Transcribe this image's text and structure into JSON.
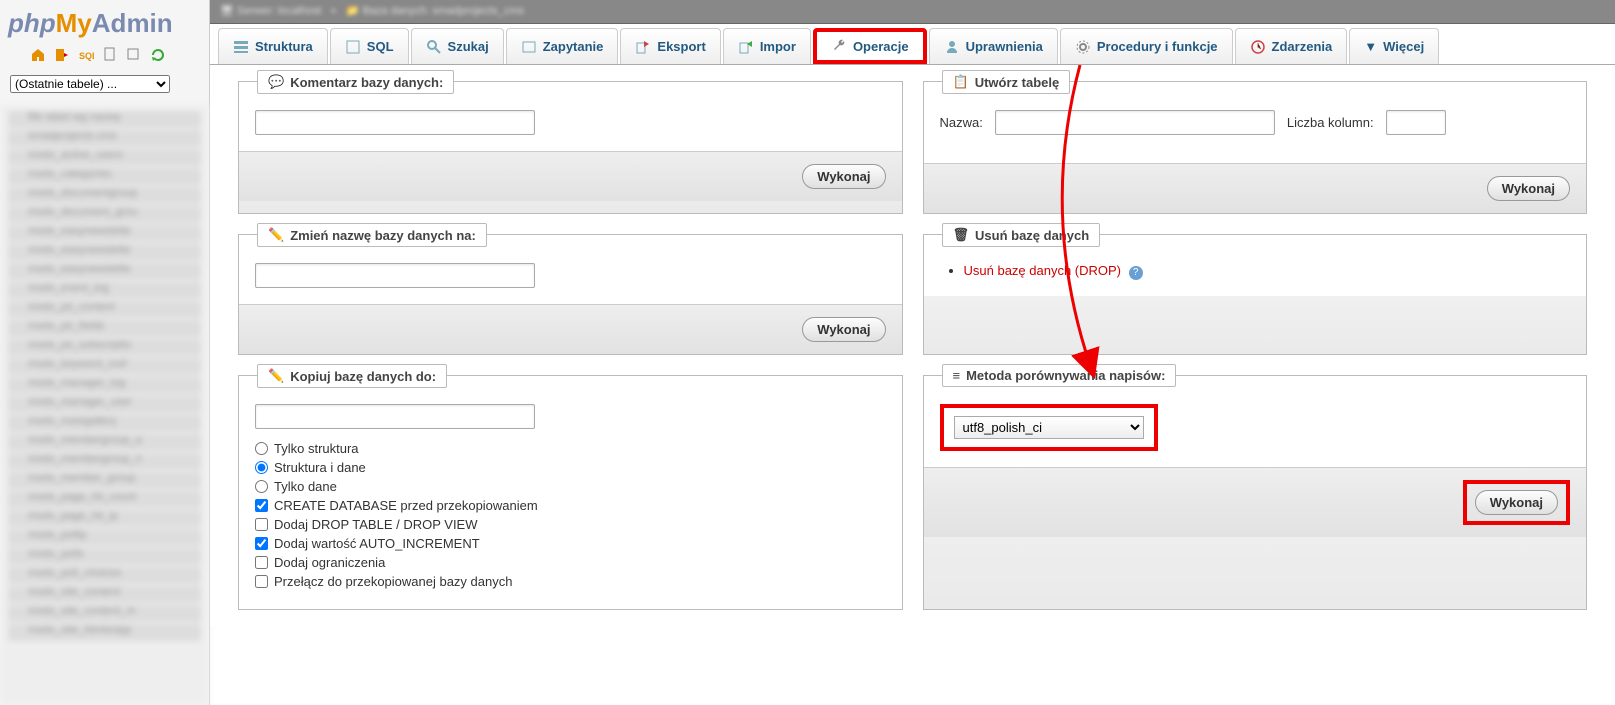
{
  "logo": {
    "php": "php",
    "my": "My",
    "admin": "Admin"
  },
  "recent_select": "(Ostatnie tabele) ...",
  "tabs": {
    "structure": "Struktura",
    "sql": "SQL",
    "search": "Szukaj",
    "query": "Zapytanie",
    "export": "Eksport",
    "import": "Impor",
    "operations": "Operacje",
    "privileges": "Uprawnienia",
    "routines": "Procedury i funkcje",
    "events": "Zdarzenia",
    "more": "Więcej"
  },
  "panels": {
    "comment": {
      "title": "Komentarz bazy danych:",
      "button": "Wykonaj"
    },
    "create_table": {
      "title": "Utwórz tabelę",
      "name_label": "Nazwa:",
      "cols_label": "Liczba kolumn:",
      "button": "Wykonaj"
    },
    "rename": {
      "title": "Zmień nazwę bazy danych na:",
      "button": "Wykonaj"
    },
    "drop": {
      "title": "Usuń bazę danych",
      "link": "Usuń bazę danych (DROP)"
    },
    "copy": {
      "title": "Kopiuj bazę danych do:",
      "radio_structure": "Tylko struktura",
      "radio_both": "Struktura i dane",
      "radio_data": "Tylko dane",
      "check_create": "CREATE DATABASE przed przekopiowaniem",
      "check_drop": "Dodaj DROP TABLE / DROP VIEW",
      "check_autoinc": "Dodaj wartość AUTO_INCREMENT",
      "check_constraints": "Dodaj ograniczenia",
      "check_switch": "Przełącz do przekopiowanej bazy danych"
    },
    "collation": {
      "title": "Metoda porównywania napisów:",
      "value": "utf8_polish_ci",
      "button": "Wykonaj"
    }
  },
  "side_items": [
    "filtr tabel wg nazwy",
    "smadprojects.cms",
    "modx_active_users",
    "modx_categories",
    "modx_documentgroup",
    "modx_document_grou",
    "modx_easynewslette",
    "modx_easynewslette",
    "modx_easynewslette",
    "modx_event_log",
    "modx_jot_content",
    "modx_jot_fields",
    "modx_jot_subscriptio",
    "modx_keyword_xref",
    "modx_manager_log",
    "modx_manager_user",
    "modx_maxigallery",
    "modx_membergroup_a",
    "modx_membergroup_n",
    "modx_member_group",
    "modx_page_hit_count",
    "modx_page_hit_ip",
    "modx_pollip",
    "modx_polls",
    "modx_poll_choices",
    "modx_site_content",
    "modx_site_content_m",
    "modx_site_htmlsnipp"
  ]
}
